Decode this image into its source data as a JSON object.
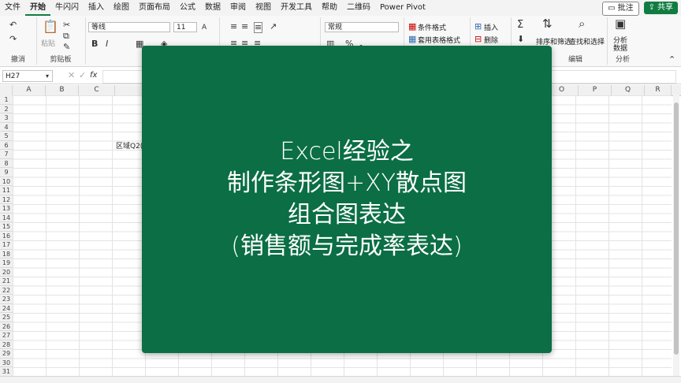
{
  "menu": {
    "tabs": [
      "文件",
      "开始",
      "牛闪闪",
      "插入",
      "绘图",
      "页面布局",
      "公式",
      "数据",
      "审阅",
      "视图",
      "开发工具",
      "帮助",
      "二维码",
      "Power Pivot"
    ],
    "active_tab": "开始",
    "comment_label": "批注",
    "share_label": "共享"
  },
  "ribbon": {
    "groups": {
      "undo": "撤消",
      "clipboard": "剪贴板",
      "edit": "编辑",
      "analysis": "分析"
    },
    "paste_label": "粘贴",
    "font_name": "等线",
    "font_size": "11",
    "number_format": "常规",
    "conditional_format": "条件格式",
    "table_format": "套用表格格式",
    "insert": "插入",
    "delete": "删除",
    "sort_filter": "排序和筛选",
    "find_select": "查找和选择",
    "analyze_data_1": "分析",
    "analyze_data_2": "数据",
    "bold": "B",
    "italic": "I",
    "sigma": "Σ",
    "percent": "%"
  },
  "formula_bar": {
    "name_box": "H27",
    "fx": "fx",
    "content": ""
  },
  "sheet": {
    "columns": [
      "A",
      "B",
      "C",
      "O",
      "P",
      "Q",
      "R"
    ],
    "rows": [
      "1",
      "2",
      "3",
      "4",
      "5",
      "6",
      "7",
      "8",
      "9",
      "10",
      "11",
      "12",
      "13",
      "14",
      "15",
      "16",
      "17",
      "18",
      "19",
      "20",
      "21",
      "22",
      "23",
      "24",
      "25",
      "26",
      "27",
      "28",
      "29",
      "30",
      "31"
    ],
    "visible_cell_text": "区域Q2("
  },
  "overlay": {
    "lines": [
      "Excel经验之",
      "制作条形图+XY散点图",
      "组合图表达",
      "(销售额与完成率表达)"
    ],
    "background": "#0b6e44"
  },
  "colors": {
    "accent": "#107c41"
  }
}
